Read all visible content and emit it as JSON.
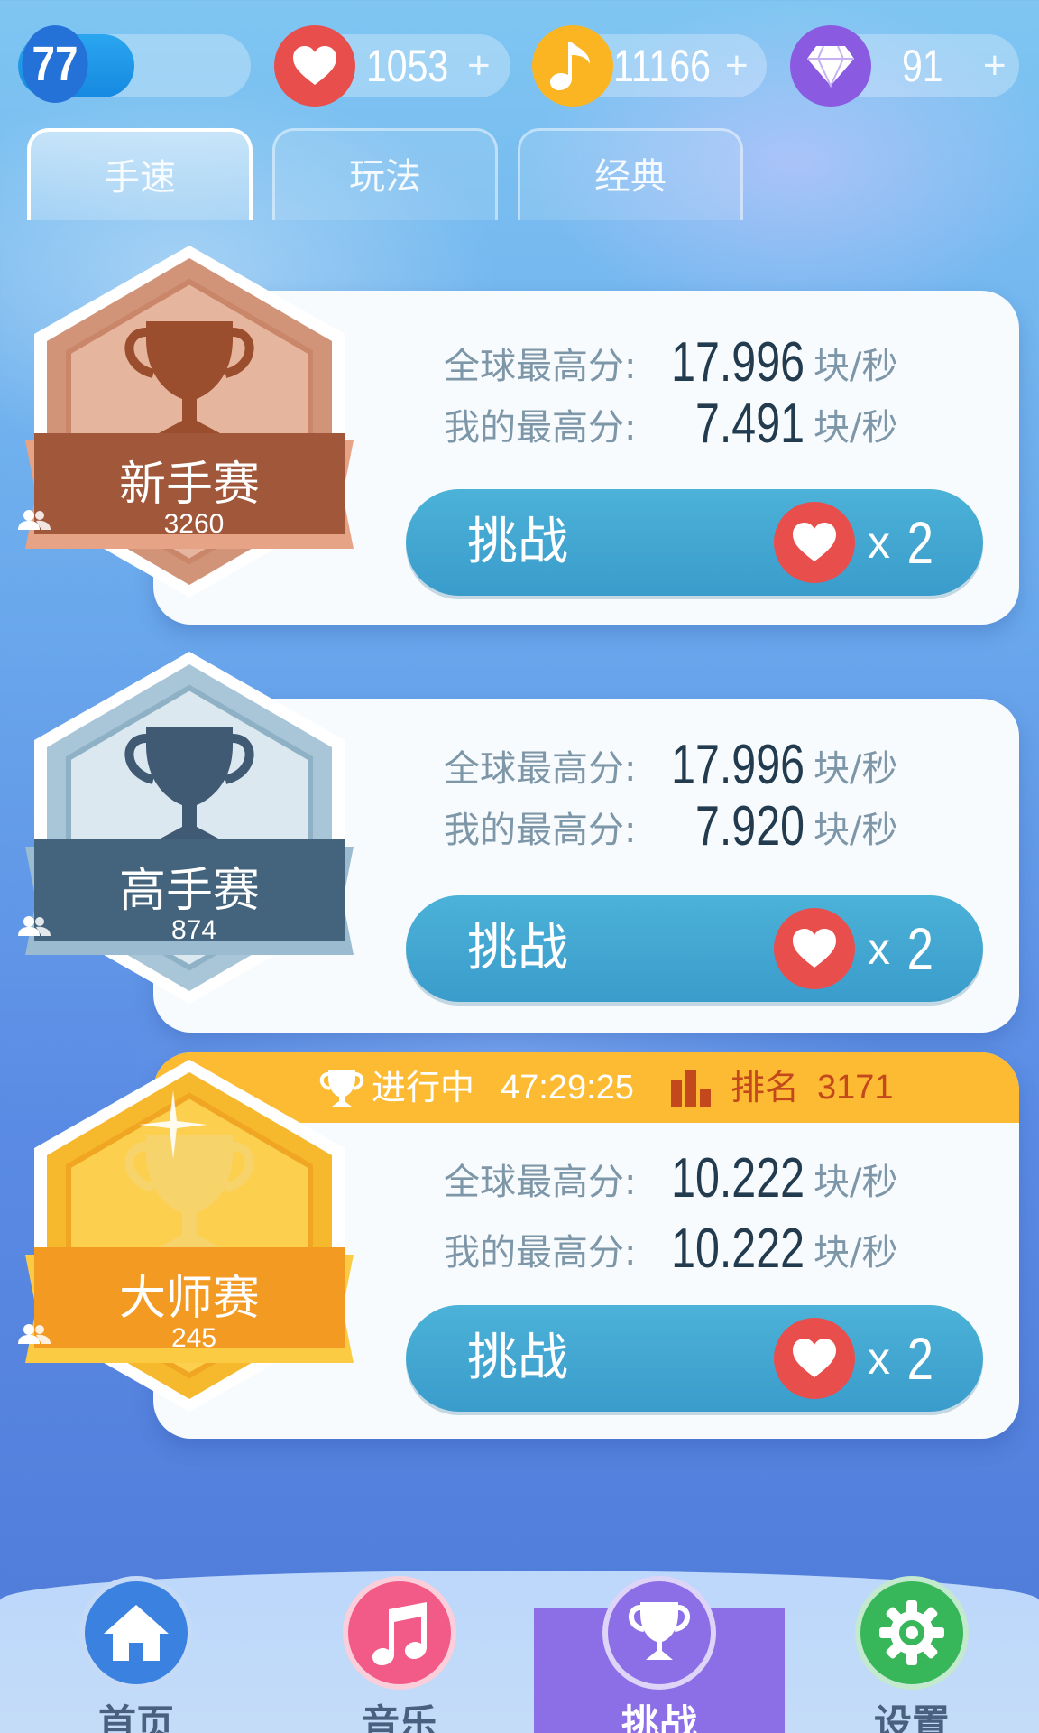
{
  "status_bar": {
    "level": "77",
    "level_progress": 0.5,
    "hearts": "1053",
    "notes": "11166",
    "gems": "91",
    "plus": "+"
  },
  "tabs": [
    {
      "label": "手速",
      "active": true
    },
    {
      "label": "玩法",
      "active": false
    },
    {
      "label": "经典",
      "active": false
    }
  ],
  "contests": [
    {
      "name": "新手赛",
      "players": "3260",
      "global_label": "全球最高分:",
      "global_score": "17.996",
      "my_label": "我的最高分:",
      "my_score": "7.491",
      "unit": "块/秒",
      "button_label": "挑战",
      "cost_x": "x",
      "cost_n": "2",
      "theme": "bronze"
    },
    {
      "name": "高手赛",
      "players": "874",
      "global_label": "全球最高分:",
      "global_score": "17.996",
      "my_label": "我的最高分:",
      "my_score": "7.920",
      "unit": "块/秒",
      "button_label": "挑战",
      "cost_x": "x",
      "cost_n": "2",
      "theme": "silver"
    },
    {
      "name": "大师赛",
      "players": "245",
      "global_label": "全球最高分:",
      "global_score": "10.222",
      "my_label": "我的最高分:",
      "my_score": "10.222",
      "unit": "块/秒",
      "button_label": "挑战",
      "cost_x": "x",
      "cost_n": "2",
      "theme": "gold",
      "banner": {
        "status": "进行中",
        "time": "47:29:25",
        "rank_label": "排名",
        "rank_value": "3171"
      }
    }
  ],
  "bottom_nav": [
    {
      "label": "首页",
      "icon": "home-icon",
      "color": "#3b82e0"
    },
    {
      "label": "音乐",
      "icon": "music-note-icon",
      "color": "#f25b88"
    },
    {
      "label": "挑战",
      "icon": "trophy-icon",
      "color": "#8c6fe6",
      "active": true
    },
    {
      "label": "设置",
      "icon": "gear-icon",
      "color": "#38b65a"
    }
  ],
  "colors": {
    "heart": "#e84e4c",
    "note": "#fbb522",
    "gem": "#8a5be0",
    "button": "#3a9ccb",
    "banner": "#fdbb33",
    "bronze": "#a0573a",
    "silver": "#44647e",
    "gold": "#f29a22"
  }
}
